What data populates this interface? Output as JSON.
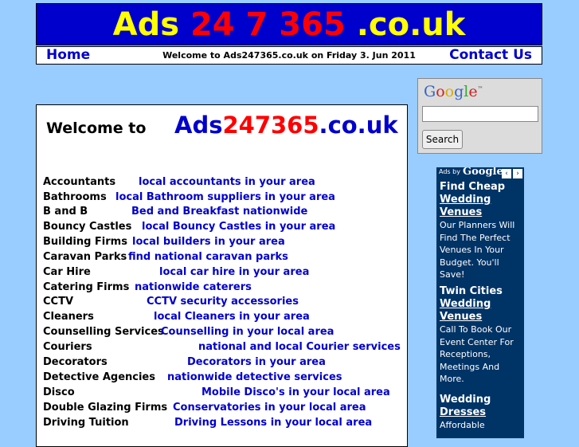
{
  "banner": {
    "part1": "Ads ",
    "part2": "24 7 365",
    "part3": " .co.uk"
  },
  "nav": {
    "home": "Home",
    "welcome_text": "Welcome to Ads247365.co.uk on Friday 3. Jun 2011",
    "contact": "Contact Us"
  },
  "google_search": {
    "logo": "Google",
    "tm": "™",
    "button": "Search",
    "input_value": ""
  },
  "main": {
    "welcome": "Welcome to",
    "site_part1": "Ads",
    "site_part2": "247365",
    "site_part3": ".co.uk",
    "rows": [
      {
        "cat": "Accountants",
        "link": "local accountants in your area"
      },
      {
        "cat": "Bathrooms",
        "link": "local Bathroom suppliers in your area"
      },
      {
        "cat": "B and B",
        "link": "Bed and Breakfast nationwide"
      },
      {
        "cat": "Bouncy Castles",
        "link": "local Bouncy Castles in your area"
      },
      {
        "cat": "Building Firms",
        "link": "local builders in your area"
      },
      {
        "cat": "Caravan Parks",
        "link": "find national caravan parks"
      },
      {
        "cat": "Car Hire",
        "link": "local car hire in your area"
      },
      {
        "cat": "Catering Firms",
        "link": "nationwide caterers"
      },
      {
        "cat": "CCTV",
        "link": "CCTV security accessories"
      },
      {
        "cat": "Cleaners",
        "link": "local Cleaners in your area"
      },
      {
        "cat": "Counselling Services",
        "link": "Counselling in your local area"
      },
      {
        "cat": "Couriers",
        "link": "national and local Courier services"
      },
      {
        "cat": "Decorators",
        "link": "Decorators in your area"
      },
      {
        "cat": "Detective Agencies",
        "link": "nationwide detective services"
      },
      {
        "cat": "Disco",
        "link": "Mobile Disco's in your local area"
      },
      {
        "cat": "Double Glazing Firms",
        "link": "Conservatories in your local area"
      },
      {
        "cat": "Driving Tuition",
        "link": "Driving Lessons in your local area"
      }
    ]
  },
  "ads": {
    "header_text": "Ads by",
    "header_logo": "Google",
    "prev": "‹",
    "next": "›",
    "items": [
      {
        "line1": "Find Cheap",
        "line2": "Wedding",
        "line3": "Venues",
        "desc": "Our Planners Will Find The Perfect Venues In Your Budget. You'll Save!"
      },
      {
        "line1": "Twin Cities",
        "line2": "Wedding",
        "line3": "Venues",
        "desc": "Call To Book Our Event Center For Receptions, Meetings And More."
      },
      {
        "line1": "Wedding",
        "line2": "Dresses",
        "line3": "",
        "desc": "Affordable"
      }
    ]
  },
  "colors": {
    "background": "#99ccff",
    "banner_bg": "#0000cc",
    "banner_text": "#ffff00",
    "accent_red": "#ff0000",
    "link": "#0000cc",
    "ad_bg": "#003366"
  }
}
